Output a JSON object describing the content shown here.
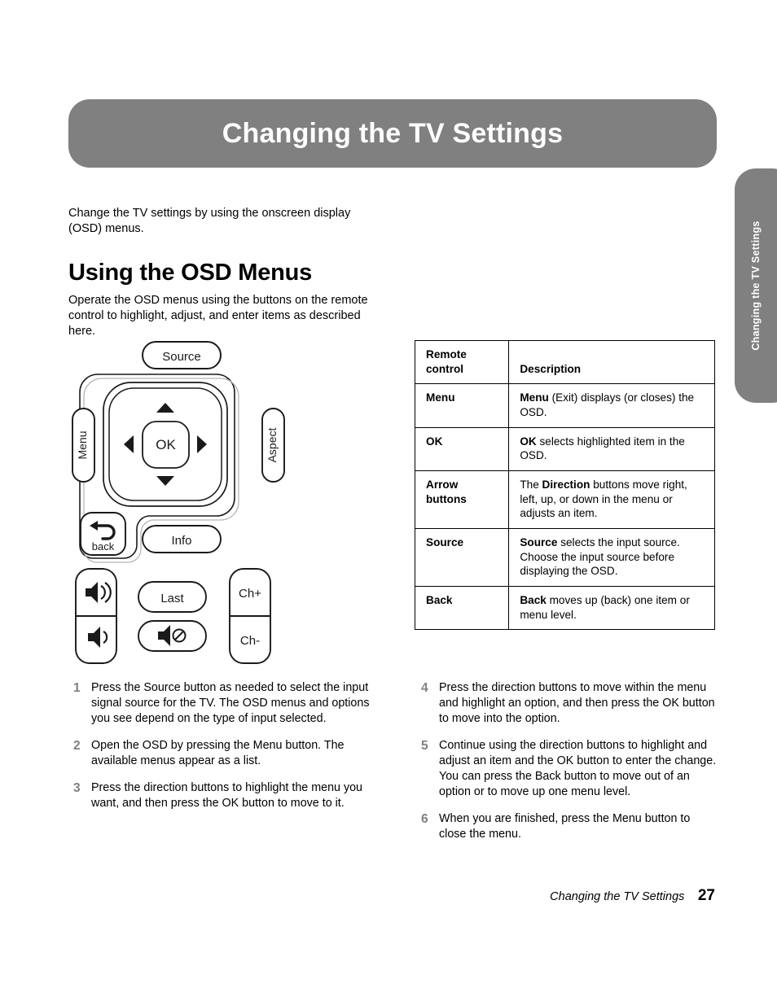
{
  "banner": {
    "title": "Changing the TV Settings",
    "background_color": "#808080",
    "text_color": "#ffffff"
  },
  "side_tab": {
    "label": "Changing the TV Settings",
    "background_color": "#808080",
    "text_color": "#ffffff"
  },
  "intro": "Change the TV settings by using the onscreen display (OSD) menus.",
  "heading": "Using the OSD Menus",
  "lead": "Operate the OSD menus using the buttons on the remote control to highlight, adjust, and enter items as described here.",
  "remote": {
    "source_label": "Source",
    "menu_label": "Menu",
    "aspect_label": "Aspect",
    "ok_label": "OK",
    "back_label": "back",
    "info_label": "Info",
    "last_label": "Last",
    "channel_up_label": "Ch+",
    "channel_down_label": "Ch-"
  },
  "table": {
    "header": {
      "col1": "Remote control",
      "col1_line1": "Remote",
      "col1_line2": "control",
      "col2": "Description"
    },
    "rows": [
      {
        "control": "Menu",
        "description_bold": "Menu",
        "description_rest": " (Exit) displays (or closes) the OSD."
      },
      {
        "control": "OK",
        "description_bold": "OK",
        "description_rest": " selects highlighted item in the OSD."
      },
      {
        "control": "Arrow buttons",
        "control_line1": "Arrow",
        "control_line2": "buttons",
        "description_prefix": "The ",
        "description_bold": "Direction",
        "description_rest": " buttons move right, left, up, or down in the menu or adjusts an item."
      },
      {
        "control": "Source",
        "description_bold": "Source",
        "description_rest": " selects the input source. Choose the input source before displaying the OSD."
      },
      {
        "control": "Back",
        "description_bold": "Back",
        "description_rest": " moves up (back) one item or menu level."
      }
    ]
  },
  "steps_left": [
    {
      "number": "1",
      "text": "Press the Source button as needed to select the input signal source for the TV. The OSD menus and options you see depend on the type of input selected."
    },
    {
      "number": "2",
      "text": "Open the OSD by pressing the Menu button. The available menus appear as a list."
    },
    {
      "number": "3",
      "text": "Press the direction buttons to highlight the menu you want, and then press the OK button to move to it."
    }
  ],
  "steps_right": [
    {
      "number": "4",
      "text": "Press the direction buttons to move within the menu and highlight an option, and then press the OK button to move into the option."
    },
    {
      "number": "5",
      "text": "Continue using the direction buttons to highlight and adjust an item and the OK button to enter the change. You can press the Back button to move out of an option or to move up one menu level."
    },
    {
      "number": "6",
      "text": "When you are finished, press the Menu button to close the menu."
    }
  ],
  "footer": {
    "title": "Changing the TV Settings",
    "page_number": "27"
  }
}
